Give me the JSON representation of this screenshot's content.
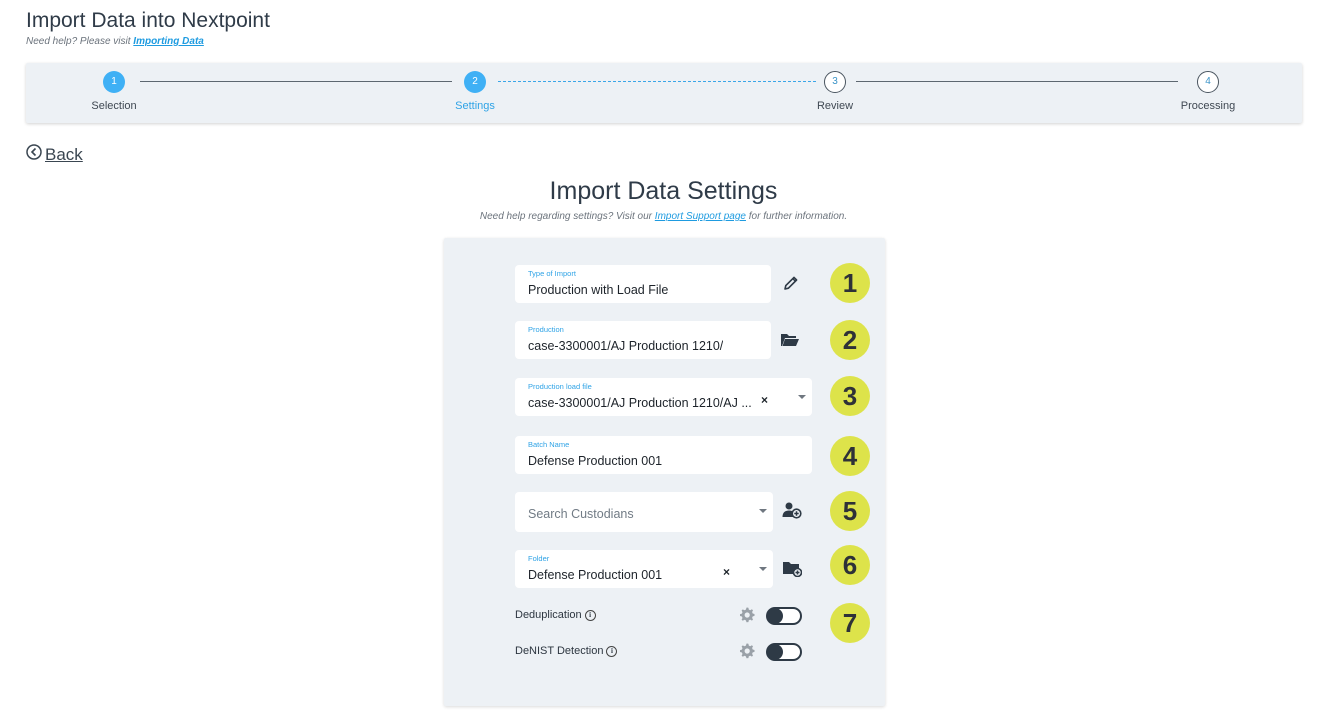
{
  "header": {
    "title": "Import Data into Nextpoint",
    "help_prefix": "Need help? Please visit",
    "help_link": "Importing Data"
  },
  "stepper": {
    "steps": [
      {
        "number": "1",
        "label": "Selection",
        "state": "done"
      },
      {
        "number": "2",
        "label": "Settings",
        "state": "active"
      },
      {
        "number": "3",
        "label": "Review",
        "state": "todo"
      },
      {
        "number": "4",
        "label": "Processing",
        "state": "todo"
      }
    ]
  },
  "back_label": "Back",
  "settings": {
    "title": "Import Data Settings",
    "help_prefix": "Need help regarding settings? Visit our",
    "help_link": "Import Support page",
    "help_suffix": "for further information."
  },
  "form": {
    "type_of_import": {
      "label": "Type of Import",
      "value": "Production with Load File"
    },
    "production": {
      "label": "Production",
      "value": "case-3300001/AJ Production 1210/"
    },
    "load_file": {
      "label": "Production load file",
      "value": "case-3300001/AJ Production 1210/AJ ..."
    },
    "batch_name": {
      "label": "Batch Name",
      "value": "Defense Production 001"
    },
    "custodians": {
      "placeholder": "Search Custodians"
    },
    "folder": {
      "label": "Folder",
      "value": "Defense Production 001"
    },
    "deduplication": {
      "label": "Deduplication",
      "enabled": false
    },
    "denist": {
      "label": "DeNIST Detection",
      "enabled": false
    }
  },
  "badges": [
    "1",
    "2",
    "3",
    "4",
    "5",
    "6",
    "7"
  ],
  "icons": {
    "edit": "pencil-icon",
    "browse": "folder-open-icon",
    "add_custodian": "add-person-icon",
    "add_folder": "add-folder-icon",
    "settings": "gear-icon",
    "info": "info-icon",
    "back": "chevron-left-circle-icon"
  },
  "colors": {
    "accent": "#3fb0f5",
    "badge": "#dde34a",
    "panel_bg": "#edf1f5"
  }
}
